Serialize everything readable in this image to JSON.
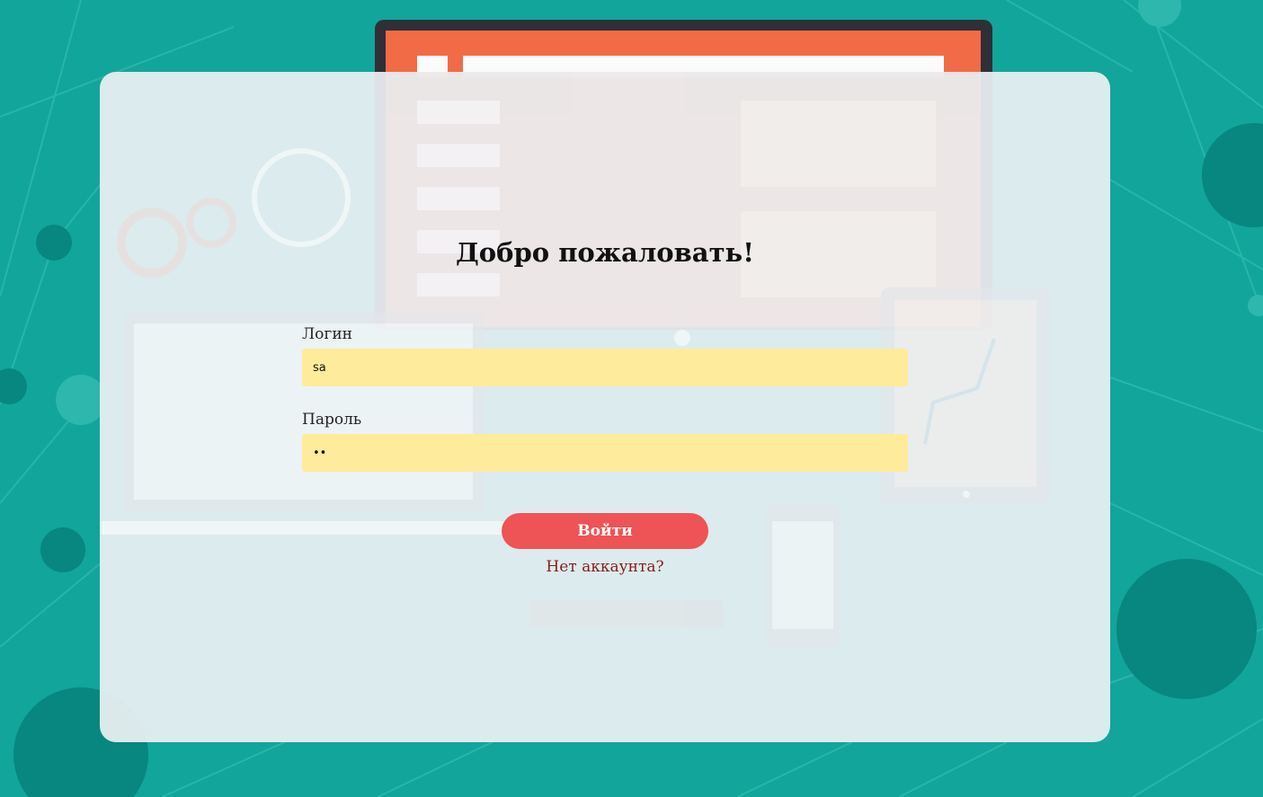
{
  "login": {
    "title": "Добро пожаловать!",
    "username_label": "Логин",
    "username_value": "sa",
    "password_label": "Пароль",
    "password_value": "12",
    "submit_label": "Войти",
    "register_link": "Нет аккаунта?"
  },
  "colors": {
    "background": "#12a59b",
    "input_fill": "#ffeb9c",
    "button": "#ee5356",
    "link": "#8b1a1a"
  }
}
